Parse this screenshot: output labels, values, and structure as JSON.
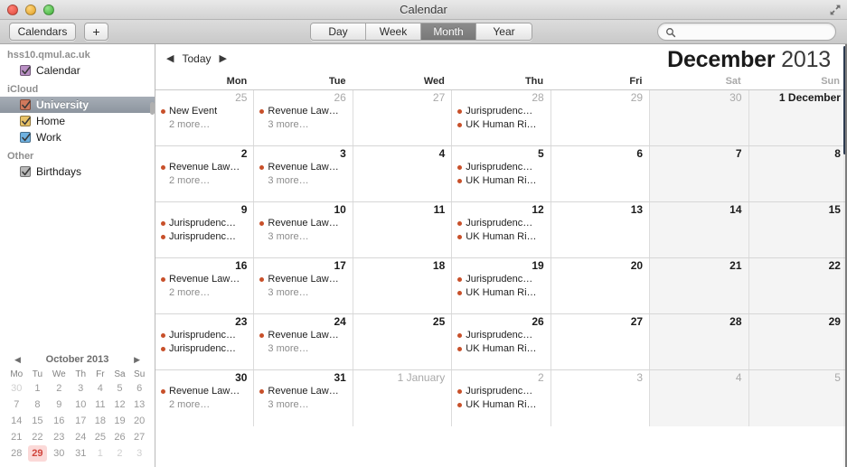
{
  "window": {
    "title": "Calendar",
    "traffic_lights": [
      "close",
      "minimize",
      "maximize"
    ],
    "fullscreen_icon": "fullscreen-arrows-icon"
  },
  "toolbar": {
    "calendars_label": "Calendars",
    "add_label": "+",
    "view_segments": [
      {
        "label": "Day",
        "active": false
      },
      {
        "label": "Week",
        "active": false
      },
      {
        "label": "Month",
        "active": true
      },
      {
        "label": "Year",
        "active": false
      }
    ],
    "search": {
      "value": "",
      "placeholder": "",
      "icon": "search-icon"
    }
  },
  "sidebar": {
    "groups": [
      {
        "name": "hss10.qmul.ac.uk",
        "calendars": [
          {
            "label": "Calendar",
            "checked": true,
            "color": "#b98fc4",
            "selected": false
          }
        ]
      },
      {
        "name": "iCloud",
        "calendars": [
          {
            "label": "University",
            "checked": true,
            "color": "#d1795c",
            "selected": true
          },
          {
            "label": "Home",
            "checked": true,
            "color": "#e8c266",
            "selected": false
          },
          {
            "label": "Work",
            "checked": true,
            "color": "#6fb1e0",
            "selected": false
          }
        ]
      },
      {
        "name": "Other",
        "calendars": [
          {
            "label": "Birthdays",
            "checked": true,
            "color": "#b8b8b8",
            "selected": false
          }
        ]
      }
    ],
    "minicalendar": {
      "title": "October 2013",
      "prev_icon": "triangle-left-icon",
      "next_icon": "triangle-right-icon",
      "weekday_headers": [
        "Mo",
        "Tu",
        "We",
        "Th",
        "Fr",
        "Sa",
        "Su"
      ],
      "weeks": [
        [
          {
            "d": "30",
            "dim": true
          },
          {
            "d": "1"
          },
          {
            "d": "2"
          },
          {
            "d": "3"
          },
          {
            "d": "4"
          },
          {
            "d": "5"
          },
          {
            "d": "6"
          }
        ],
        [
          {
            "d": "7"
          },
          {
            "d": "8"
          },
          {
            "d": "9"
          },
          {
            "d": "10"
          },
          {
            "d": "11"
          },
          {
            "d": "12"
          },
          {
            "d": "13"
          }
        ],
        [
          {
            "d": "14"
          },
          {
            "d": "15"
          },
          {
            "d": "16"
          },
          {
            "d": "17"
          },
          {
            "d": "18"
          },
          {
            "d": "19"
          },
          {
            "d": "20"
          }
        ],
        [
          {
            "d": "21"
          },
          {
            "d": "22"
          },
          {
            "d": "23"
          },
          {
            "d": "24"
          },
          {
            "d": "25"
          },
          {
            "d": "26"
          },
          {
            "d": "27"
          }
        ],
        [
          {
            "d": "28"
          },
          {
            "d": "29",
            "today": true
          },
          {
            "d": "30"
          },
          {
            "d": "31"
          },
          {
            "d": "1",
            "dim": true
          },
          {
            "d": "2",
            "dim": true
          },
          {
            "d": "3",
            "dim": true
          }
        ]
      ]
    }
  },
  "main": {
    "nav": {
      "prev_icon": "triangle-left-icon",
      "today_label": "Today",
      "next_icon": "triangle-right-icon"
    },
    "month_name": "December",
    "year": "2013",
    "weekday_headers": [
      {
        "label": "Mon",
        "weekend": false
      },
      {
        "label": "Tue",
        "weekend": false
      },
      {
        "label": "Wed",
        "weekend": false
      },
      {
        "label": "Thu",
        "weekend": false
      },
      {
        "label": "Fri",
        "weekend": false
      },
      {
        "label": "Sat",
        "weekend": true
      },
      {
        "label": "Sun",
        "weekend": true
      }
    ],
    "event_dot_color": "#c8502a",
    "weeks": [
      [
        {
          "num": "25",
          "other": true,
          "events": [
            "New Event"
          ],
          "more": "2 more…"
        },
        {
          "num": "26",
          "other": true,
          "events": [
            "Revenue Law…"
          ],
          "more": "3 more…"
        },
        {
          "num": "27",
          "other": true,
          "events": [],
          "more": ""
        },
        {
          "num": "28",
          "other": true,
          "events": [
            "Jurisprudenc…",
            "UK Human Ri…"
          ],
          "more": ""
        },
        {
          "num": "29",
          "other": true,
          "events": [],
          "more": ""
        },
        {
          "num": "30",
          "other": true,
          "weekend": true,
          "events": [],
          "more": ""
        },
        {
          "num": "1 December",
          "other": false,
          "weekend": true,
          "events": [],
          "more": ""
        }
      ],
      [
        {
          "num": "2",
          "events": [
            "Revenue Law…"
          ],
          "more": "2 more…"
        },
        {
          "num": "3",
          "events": [
            "Revenue Law…"
          ],
          "more": "3 more…"
        },
        {
          "num": "4",
          "events": [],
          "more": ""
        },
        {
          "num": "5",
          "events": [
            "Jurisprudenc…",
            "UK Human Ri…"
          ],
          "more": ""
        },
        {
          "num": "6",
          "events": [],
          "more": ""
        },
        {
          "num": "7",
          "weekend": true,
          "events": [],
          "more": ""
        },
        {
          "num": "8",
          "weekend": true,
          "events": [],
          "more": ""
        }
      ],
      [
        {
          "num": "9",
          "events": [
            "Jurisprudenc…",
            "Jurisprudenc…"
          ],
          "more": ""
        },
        {
          "num": "10",
          "events": [
            "Revenue Law…"
          ],
          "more": "3 more…"
        },
        {
          "num": "11",
          "events": [],
          "more": ""
        },
        {
          "num": "12",
          "events": [
            "Jurisprudenc…",
            "UK Human Ri…"
          ],
          "more": ""
        },
        {
          "num": "13",
          "events": [],
          "more": ""
        },
        {
          "num": "14",
          "weekend": true,
          "events": [],
          "more": ""
        },
        {
          "num": "15",
          "weekend": true,
          "events": [],
          "more": ""
        }
      ],
      [
        {
          "num": "16",
          "events": [
            "Revenue Law…"
          ],
          "more": "2 more…"
        },
        {
          "num": "17",
          "events": [
            "Revenue Law…"
          ],
          "more": "3 more…"
        },
        {
          "num": "18",
          "events": [],
          "more": ""
        },
        {
          "num": "19",
          "events": [
            "Jurisprudenc…",
            "UK Human Ri…"
          ],
          "more": ""
        },
        {
          "num": "20",
          "events": [],
          "more": ""
        },
        {
          "num": "21",
          "weekend": true,
          "events": [],
          "more": ""
        },
        {
          "num": "22",
          "weekend": true,
          "events": [],
          "more": ""
        }
      ],
      [
        {
          "num": "23",
          "events": [
            "Jurisprudenc…",
            "Jurisprudenc…"
          ],
          "more": ""
        },
        {
          "num": "24",
          "events": [
            "Revenue Law…"
          ],
          "more": "3 more…"
        },
        {
          "num": "25",
          "events": [],
          "more": ""
        },
        {
          "num": "26",
          "events": [
            "Jurisprudenc…",
            "UK Human Ri…"
          ],
          "more": ""
        },
        {
          "num": "27",
          "events": [],
          "more": ""
        },
        {
          "num": "28",
          "weekend": true,
          "events": [],
          "more": ""
        },
        {
          "num": "29",
          "weekend": true,
          "events": [],
          "more": ""
        }
      ],
      [
        {
          "num": "30",
          "events": [
            "Revenue Law…"
          ],
          "more": "2 more…"
        },
        {
          "num": "31",
          "events": [
            "Revenue Law…"
          ],
          "more": "3 more…"
        },
        {
          "num": "1 January",
          "other": true,
          "events": [],
          "more": ""
        },
        {
          "num": "2",
          "other": true,
          "events": [
            "Jurisprudenc…",
            "UK Human Ri…"
          ],
          "more": ""
        },
        {
          "num": "3",
          "other": true,
          "events": [],
          "more": ""
        },
        {
          "num": "4",
          "other": true,
          "weekend": true,
          "events": [],
          "more": ""
        },
        {
          "num": "5",
          "other": true,
          "weekend": true,
          "events": [],
          "more": ""
        }
      ]
    ]
  }
}
